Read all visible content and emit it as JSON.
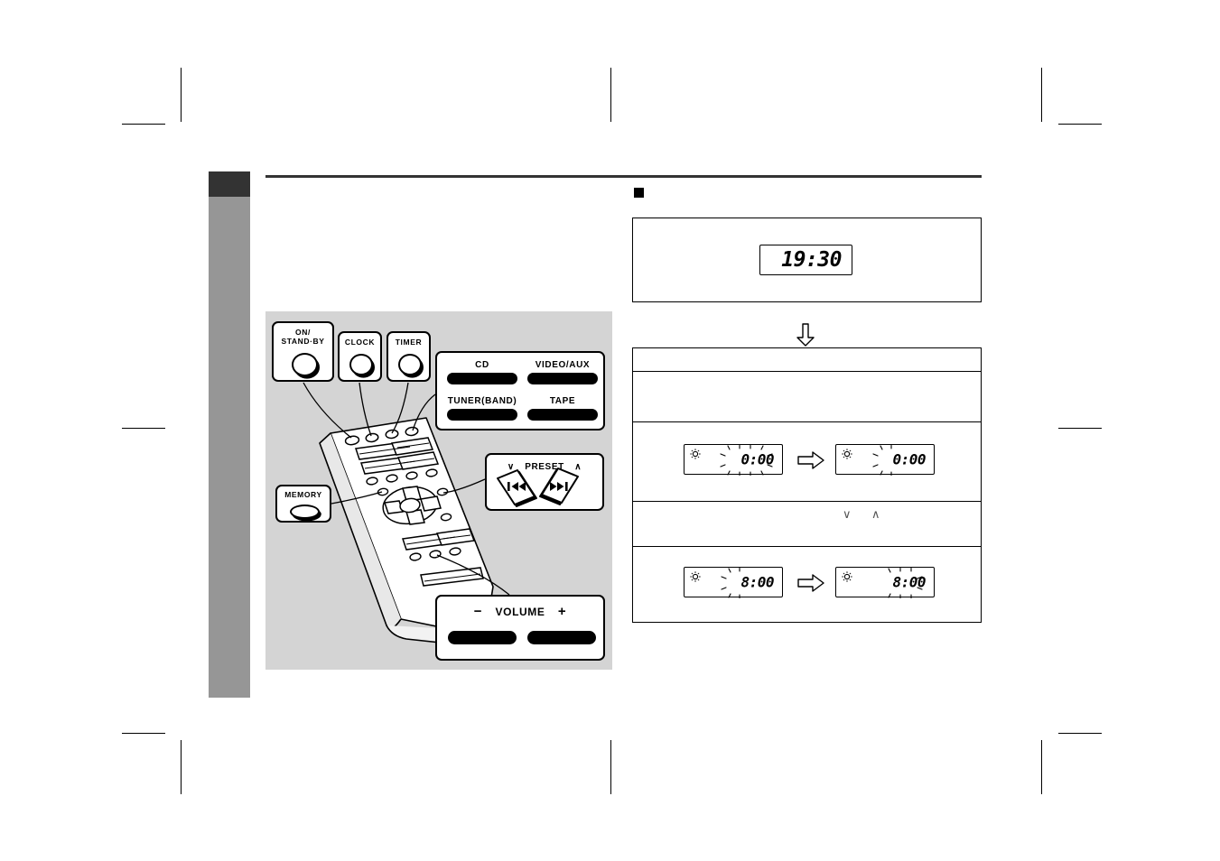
{
  "page": {
    "background": "#ffffff",
    "tab_dark_color": "#333333",
    "tab_gray_color": "#969696",
    "illustration_bg": "#d4d4d4"
  },
  "illustration": {
    "title": "remote control callouts",
    "callouts": [
      {
        "id": "on-standby",
        "label": "ON/\nSTAND·BY",
        "label_line1": "ON/",
        "label_line2": "STAND·BY",
        "key": "round"
      },
      {
        "id": "clock",
        "label": "CLOCK",
        "key": "round"
      },
      {
        "id": "timer",
        "label": "TIMER",
        "key": "round"
      },
      {
        "id": "memory",
        "label": "MEMORY",
        "key": "oblong"
      },
      {
        "id": "preset",
        "label": "PRESET",
        "chevron_down": "∨",
        "chevron_up": "∧",
        "key_left_icon": "skip-back-icon",
        "key_right_icon": "skip-forward-icon"
      },
      {
        "id": "volume",
        "label": "VOLUME",
        "minus": "−",
        "plus": "+",
        "key": "bar-pair"
      }
    ],
    "source_buttons": [
      {
        "label": "CD"
      },
      {
        "label": "VIDEO/AUX"
      },
      {
        "label": "TUNER(BAND)"
      },
      {
        "label": "TAPE"
      }
    ]
  },
  "right_column": {
    "bullet": "■",
    "clock_panel": {
      "display": {
        "value": "19:30",
        "flashing": false,
        "timer_icon": false
      }
    },
    "flow_arrow": "⇓",
    "steps": [
      {
        "id": "step-0",
        "text": ""
      },
      {
        "id": "step-1",
        "text": ""
      },
      {
        "id": "step-2",
        "text": "",
        "displays": [
          {
            "value": "0:00",
            "timer_icon": true,
            "flashing": "all"
          },
          {
            "value": "0:00",
            "timer_icon": true,
            "flashing": "hour"
          }
        ],
        "arrow": "⇨"
      },
      {
        "id": "step-3",
        "text": "",
        "chevron_down": "∨",
        "chevron_up": "∧"
      },
      {
        "id": "step-4",
        "text": "",
        "displays": [
          {
            "value": "8:00",
            "timer_icon": true,
            "flashing": "hour"
          },
          {
            "value": "8:00",
            "timer_icon": true,
            "flashing": "minute"
          }
        ],
        "arrow": "⇨"
      }
    ]
  },
  "crop_marks": {
    "count": 8,
    "color": "#000000"
  }
}
